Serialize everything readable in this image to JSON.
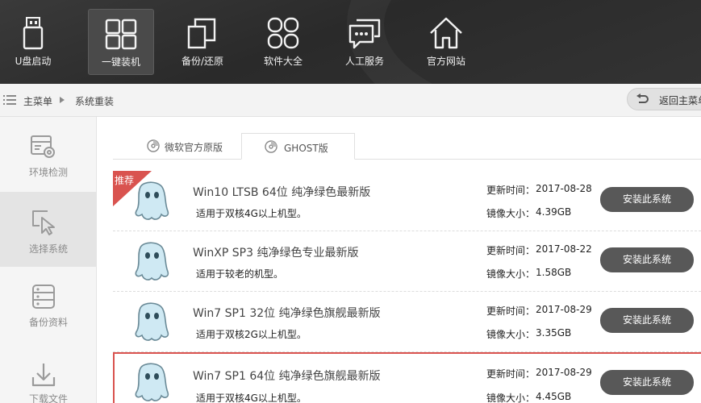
{
  "top_nav": {
    "items": [
      {
        "label": "U盘启动",
        "icon": "usb-icon",
        "active": false
      },
      {
        "label": "一键装机",
        "icon": "windows-icon",
        "active": true
      },
      {
        "label": "备份/还原",
        "icon": "backup-restore-icon",
        "active": false
      },
      {
        "label": "软件大全",
        "icon": "apps-grid-icon",
        "active": false
      },
      {
        "label": "人工服务",
        "icon": "chat-icon",
        "active": false
      },
      {
        "label": "官方网站",
        "icon": "home-icon",
        "active": false
      }
    ]
  },
  "breadcrumb": {
    "menu_icon": "list-icon",
    "root": "主菜单",
    "current": "系统重装",
    "back_label": "返回主菜单",
    "back_icon": "return-arrow-icon"
  },
  "sidebar": {
    "items": [
      {
        "label": "环境检测",
        "icon": "pc-check-icon",
        "active": false
      },
      {
        "label": "选择系统",
        "icon": "cursor-select-icon",
        "active": true
      },
      {
        "label": "备份资料",
        "icon": "database-icon",
        "active": false
      },
      {
        "label": "下载文件",
        "icon": "download-icon",
        "active": false
      }
    ]
  },
  "tabs": [
    {
      "label": "微软官方原版",
      "icon": "disc-icon",
      "active": false
    },
    {
      "label": "GHOST版",
      "icon": "disc-icon",
      "active": true
    }
  ],
  "systems": {
    "update_label": "更新时间：",
    "size_label": "镜像大小：",
    "install_label": "安装此系统",
    "recommend_label": "推荐",
    "items": [
      {
        "name": "Win10 LTSB 64位 纯净绿色最新版",
        "desc": "适用于双核4G以上机型。",
        "date": "2017-08-28",
        "size": "4.39GB",
        "recommended": true,
        "selected": false
      },
      {
        "name": "WinXP SP3 纯净绿色专业最新版",
        "desc": "适用于较老的机型。",
        "date": "2017-08-22",
        "size": "1.58GB",
        "recommended": false,
        "selected": false
      },
      {
        "name": "Win7 SP1 32位 纯净绿色旗舰最新版",
        "desc": "适用于双核2G以上机型。",
        "date": "2017-08-29",
        "size": "3.35GB",
        "recommended": false,
        "selected": false
      },
      {
        "name": "Win7 SP1 64位 纯净绿色旗舰最新版",
        "desc": "适用于双核4G以上机型。",
        "date": "2017-08-29",
        "size": "4.45GB",
        "recommended": false,
        "selected": true
      }
    ]
  },
  "colors": {
    "topbar": "#2f2f2f",
    "install_button": "#585858",
    "selected_border": "#d9534f",
    "recommend_badge": "#d9534f"
  }
}
